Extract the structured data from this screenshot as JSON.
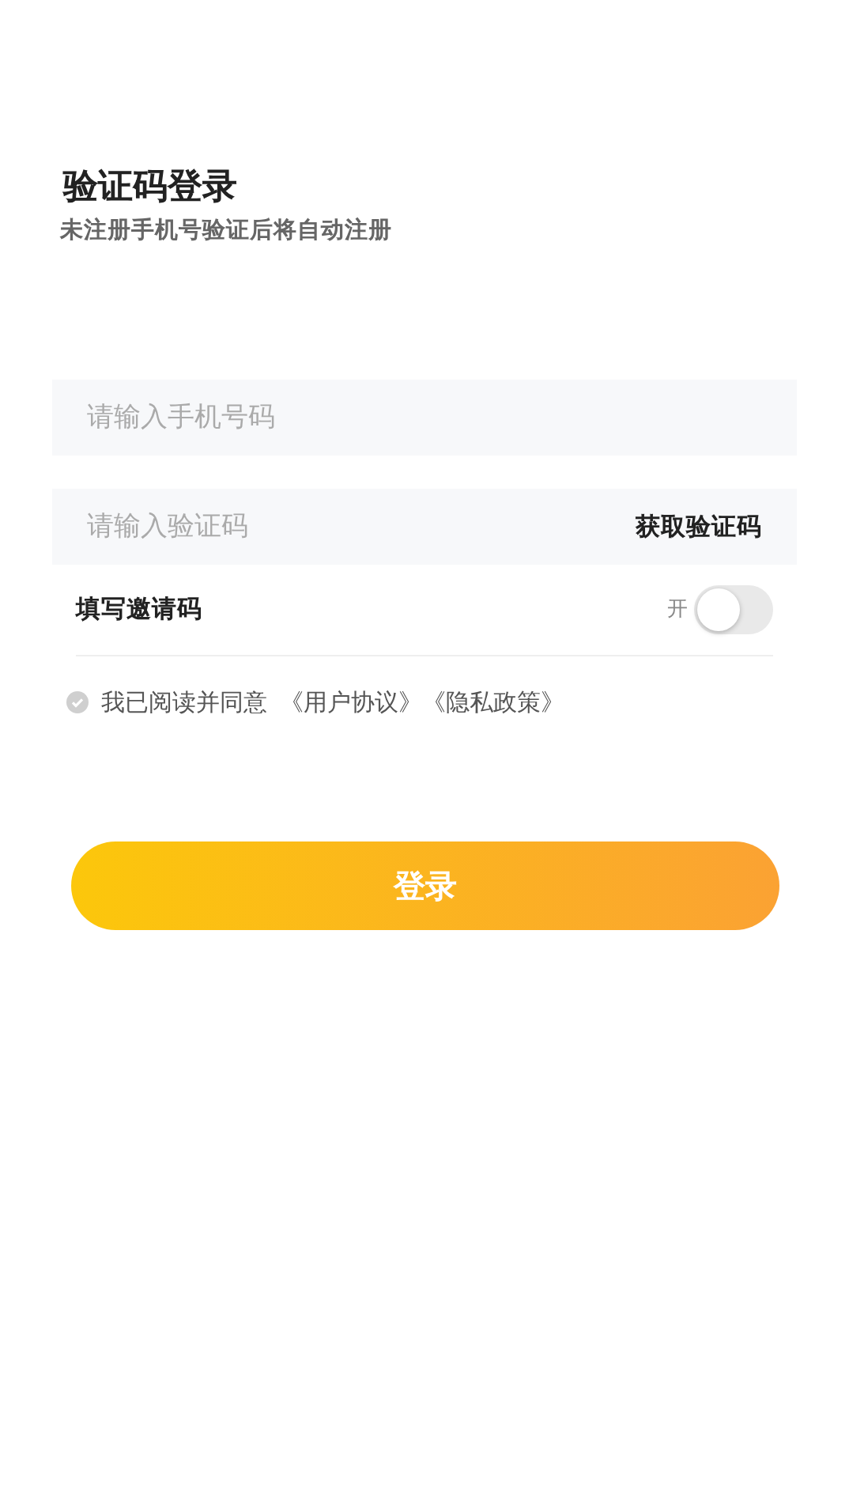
{
  "header": {
    "title": "验证码登录",
    "subtitle": "未注册手机号验证后将自动注册"
  },
  "phone_field": {
    "placeholder": "请输入手机号码"
  },
  "code_field": {
    "placeholder": "请输入验证码",
    "action": "获取验证码"
  },
  "invite_code": {
    "label": "填写邀请码",
    "switch_label": "开",
    "on": false
  },
  "agreement": {
    "checked": false,
    "text": "我已阅读并同意",
    "links": [
      "《用户协议》",
      "《隐私政策》"
    ]
  },
  "login_button": {
    "label": "登录"
  }
}
